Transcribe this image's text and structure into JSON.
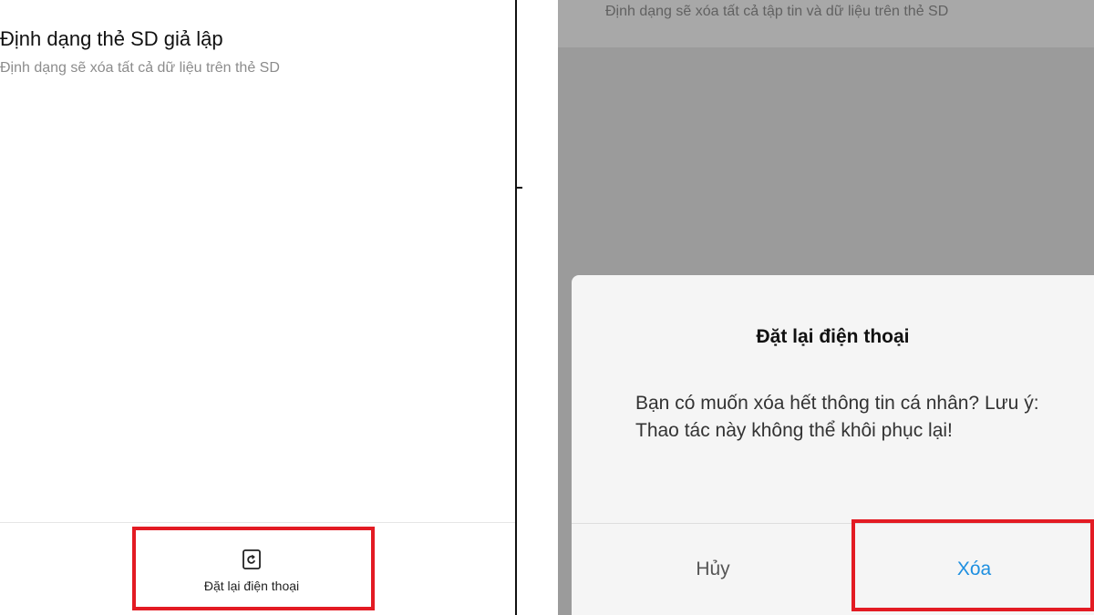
{
  "left_screen": {
    "setting_title": "Định dạng thẻ SD giả lập",
    "setting_subtitle": "Định dạng sẽ xóa tất cả dữ liệu trên thẻ SD",
    "reset_action": {
      "label": "Đặt lại điện thoại",
      "icon": "reset-phone-icon"
    }
  },
  "right_screen": {
    "background_setting_subtitle": "Định dạng sẽ xóa tất cả tập tin và dữ liệu trên thẻ SD",
    "dialog": {
      "title": "Đặt lại điện thoại",
      "message": "Bạn có muốn xóa hết thông tin cá nhân? Lưu ý: Thao tác này không thể khôi phục lại!",
      "cancel_label": "Hủy",
      "confirm_label": "Xóa"
    }
  },
  "colors": {
    "highlight_border": "#e31b23",
    "confirm_text": "#1e8fe0",
    "overlay": "#9b9b9b"
  }
}
